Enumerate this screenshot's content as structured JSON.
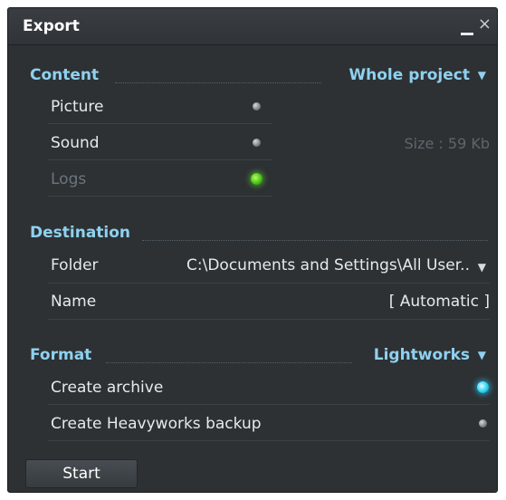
{
  "window": {
    "title": "Export",
    "minimize_icon": "minimize-icon",
    "close_glyph": "×"
  },
  "content": {
    "heading": "Content",
    "dropdown": "Whole project",
    "rows": [
      {
        "label": "Picture",
        "led": "gray",
        "enabled": true
      },
      {
        "label": "Sound",
        "led": "gray",
        "enabled": true
      },
      {
        "label": "Logs",
        "led": "green",
        "enabled": false
      }
    ],
    "size_info": "Size : 59 Kb"
  },
  "destination": {
    "heading": "Destination",
    "folder_label": "Folder",
    "folder_value": "C:\\Documents and Settings\\All User..",
    "name_label": "Name",
    "name_value": "[ Automatic ]"
  },
  "format": {
    "heading": "Format",
    "dropdown": "Lightworks",
    "rows": [
      {
        "label": "Create archive",
        "led": "cyan"
      },
      {
        "label": "Create Heavyworks backup",
        "led": "gray"
      }
    ]
  },
  "actions": {
    "start_label": "Start"
  },
  "colors": {
    "panel_bg": "#2d3134",
    "heading": "#8fd1ef",
    "text": "#e6eaed",
    "dim_text": "#6c757c",
    "led_green": "#48c41a",
    "led_cyan": "#27d3f2"
  }
}
